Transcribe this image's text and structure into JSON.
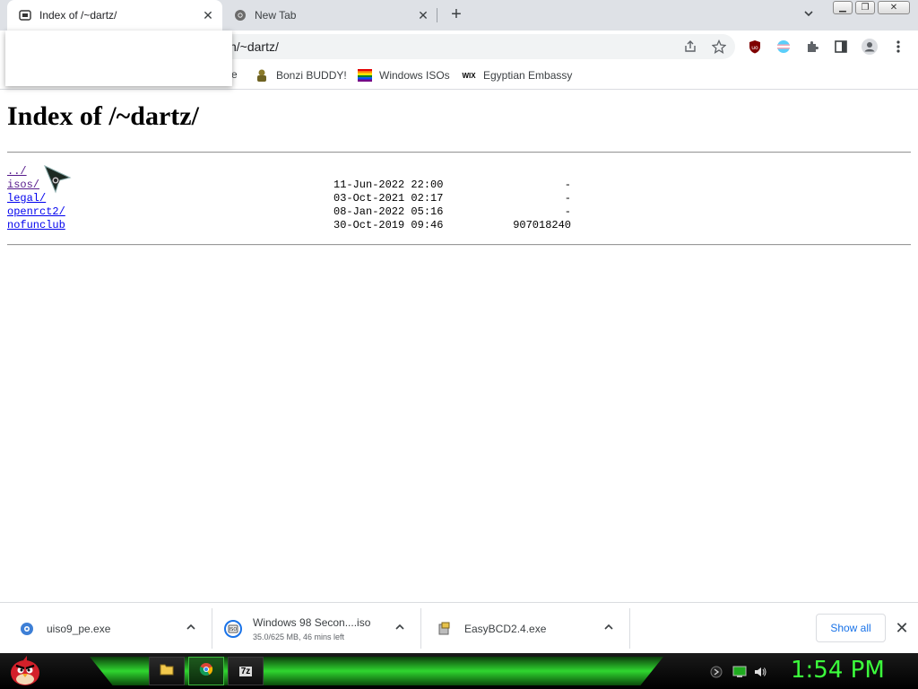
{
  "tabs": [
    {
      "label": "Index of /~dartz/",
      "active": true
    },
    {
      "label": "New Tab",
      "active": false
    }
  ],
  "window_controls": [
    "minimize",
    "restore",
    "close"
  ],
  "toolbar": {
    "url_visible": "n/~dartz/"
  },
  "bookmarks": [
    {
      "label": "e"
    },
    {
      "label": "Bonzi BUDDY!"
    },
    {
      "label": "Windows ISOs"
    },
    {
      "label": "Egyptian Embassy"
    }
  ],
  "page": {
    "title": "Index of /~dartz/",
    "entries": [
      {
        "name": "../",
        "date": "",
        "size": ""
      },
      {
        "name": "isos/",
        "date": "11-Jun-2022 22:00",
        "size": "-"
      },
      {
        "name": "legal/",
        "date": "03-Oct-2021 02:17",
        "size": "-"
      },
      {
        "name": "openrct2/",
        "date": "08-Jan-2022 05:16",
        "size": "-"
      },
      {
        "name": "nofunclub",
        "date": "30-Oct-2019 09:46",
        "size": "907018240"
      }
    ]
  },
  "downloads": {
    "items": [
      {
        "name": "uiso9_pe.exe",
        "sub": ""
      },
      {
        "name": "Windows 98 Secon....iso",
        "sub": "35.0/625 MB, 46 mins left"
      },
      {
        "name": "EasyBCD2.4.exe",
        "sub": ""
      }
    ],
    "show_all": "Show all"
  },
  "taskbar": {
    "clock": "1:54 PM",
    "apps": [
      "file-manager",
      "chrome",
      "7zip"
    ]
  }
}
